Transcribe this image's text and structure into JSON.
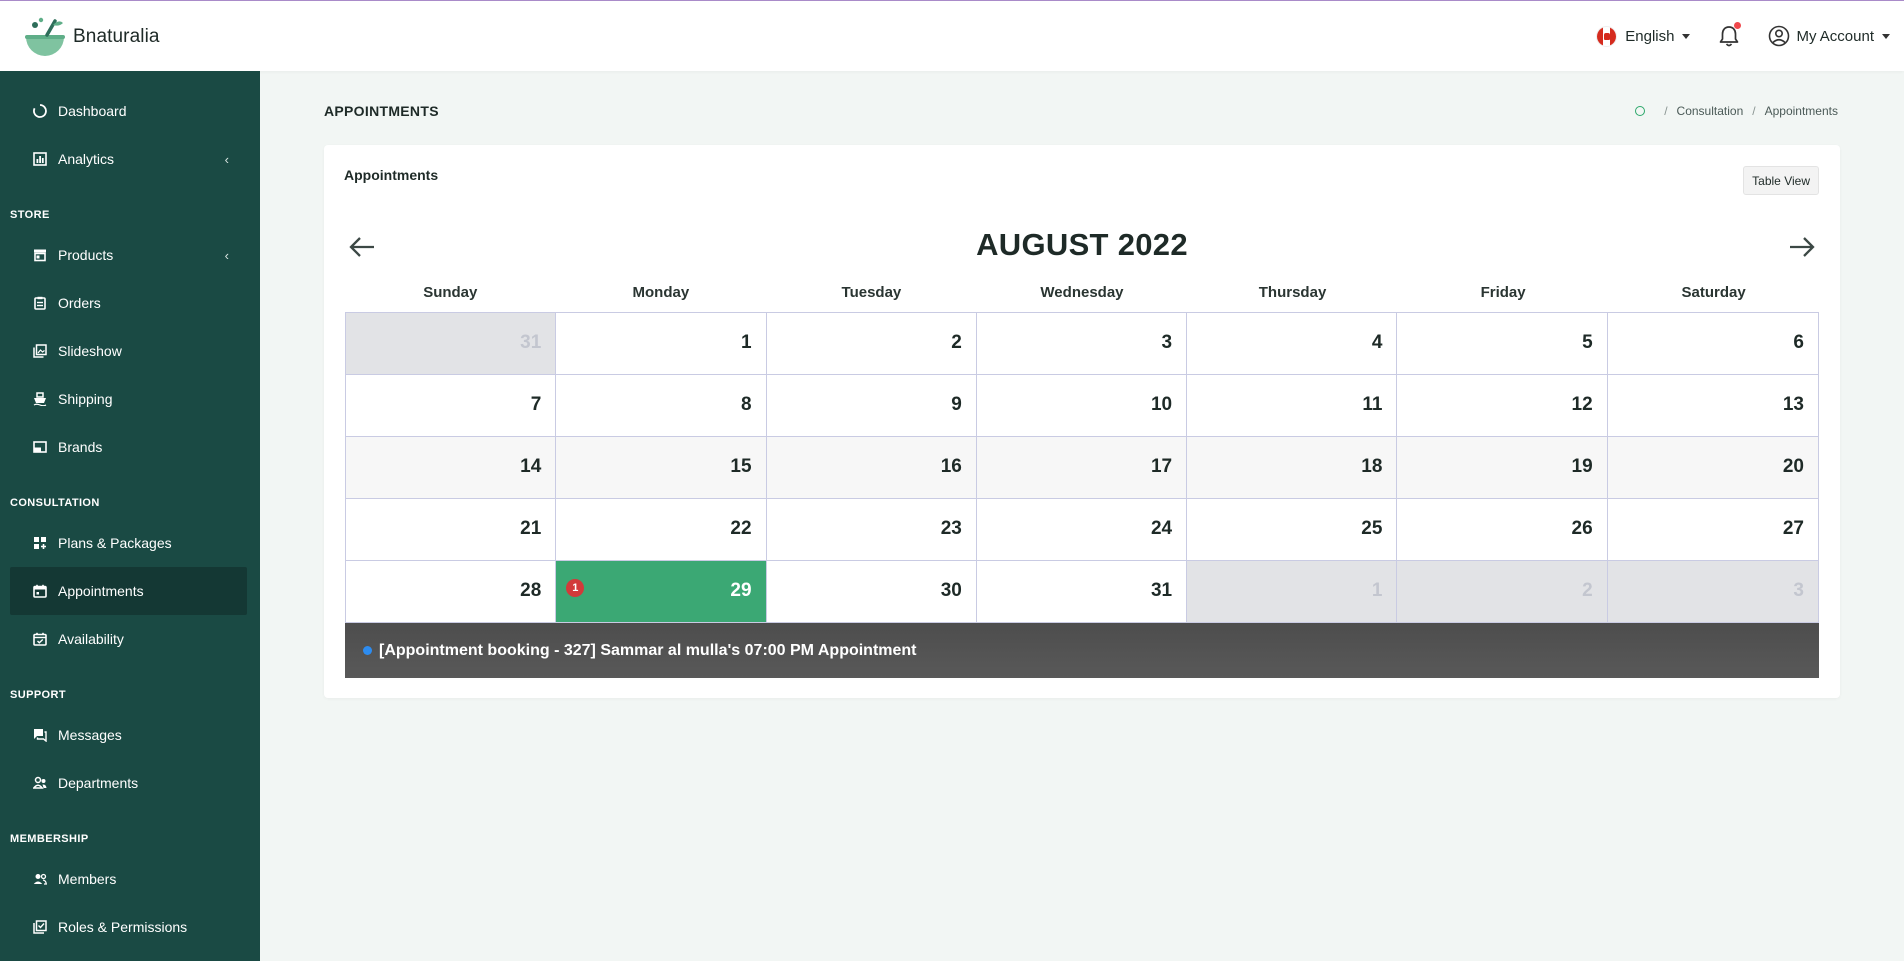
{
  "brand": {
    "name": "Bnaturalia"
  },
  "header": {
    "language": "English",
    "account": "My Account"
  },
  "sidebar": {
    "items": [
      {
        "label": "Dashboard",
        "icon": "dashboard-icon"
      },
      {
        "label": "Analytics",
        "icon": "analytics-icon",
        "has_submenu": true
      }
    ],
    "sections": [
      {
        "title": "STORE",
        "items": [
          {
            "label": "Products",
            "icon": "store-icon",
            "has_submenu": true
          },
          {
            "label": "Orders",
            "icon": "clipboard-icon"
          },
          {
            "label": "Slideshow",
            "icon": "gallery-icon"
          },
          {
            "label": "Shipping",
            "icon": "ship-icon"
          },
          {
            "label": "Brands",
            "icon": "brand-icon"
          }
        ]
      },
      {
        "title": "CONSULTATION",
        "items": [
          {
            "label": "Plans & Packages",
            "icon": "plans-icon"
          },
          {
            "label": "Appointments",
            "icon": "calendar-icon",
            "active": true
          },
          {
            "label": "Availability",
            "icon": "calendar-check-icon"
          }
        ]
      },
      {
        "title": "SUPPORT",
        "items": [
          {
            "label": "Messages",
            "icon": "messages-icon"
          },
          {
            "label": "Departments",
            "icon": "group-icon"
          }
        ]
      },
      {
        "title": "MEMBERSHIP",
        "items": [
          {
            "label": "Members",
            "icon": "members-icon"
          },
          {
            "label": "Roles & Permissions",
            "icon": "roles-icon"
          }
        ]
      }
    ]
  },
  "page": {
    "title": "APPOINTMENTS",
    "breadcrumb": [
      "Consultation",
      "Appointments"
    ]
  },
  "card": {
    "title": "Appointments",
    "table_view_label": "Table View"
  },
  "calendar": {
    "month_label": "AUGUST 2022",
    "weekdays": [
      "Sunday",
      "Monday",
      "Tuesday",
      "Wednesday",
      "Thursday",
      "Friday",
      "Saturday"
    ],
    "weeks": [
      [
        {
          "d": "31",
          "other": true
        },
        {
          "d": "1"
        },
        {
          "d": "2"
        },
        {
          "d": "3"
        },
        {
          "d": "4"
        },
        {
          "d": "5"
        },
        {
          "d": "6"
        }
      ],
      [
        {
          "d": "7"
        },
        {
          "d": "8"
        },
        {
          "d": "9"
        },
        {
          "d": "10"
        },
        {
          "d": "11"
        },
        {
          "d": "12"
        },
        {
          "d": "13"
        }
      ],
      [
        {
          "d": "14"
        },
        {
          "d": "15"
        },
        {
          "d": "16"
        },
        {
          "d": "17"
        },
        {
          "d": "18"
        },
        {
          "d": "19"
        },
        {
          "d": "20"
        }
      ],
      [
        {
          "d": "21"
        },
        {
          "d": "22"
        },
        {
          "d": "23"
        },
        {
          "d": "24"
        },
        {
          "d": "25"
        },
        {
          "d": "26"
        },
        {
          "d": "27"
        }
      ],
      [
        {
          "d": "28"
        },
        {
          "d": "29",
          "selected": true,
          "badge": "1"
        },
        {
          "d": "30"
        },
        {
          "d": "31"
        },
        {
          "d": "1",
          "other": true
        },
        {
          "d": "2",
          "other": true
        },
        {
          "d": "3",
          "other": true
        }
      ]
    ],
    "event": {
      "text": "[Appointment booking - 327] Sammar al mulla's 07:00 PM Appointment",
      "dot_color": "#2d8cf0"
    }
  },
  "colors": {
    "sidebar": "#1a4a44",
    "sidebar_active": "#143834",
    "selected_day": "#3ba874",
    "badge": "#d23a3a"
  }
}
